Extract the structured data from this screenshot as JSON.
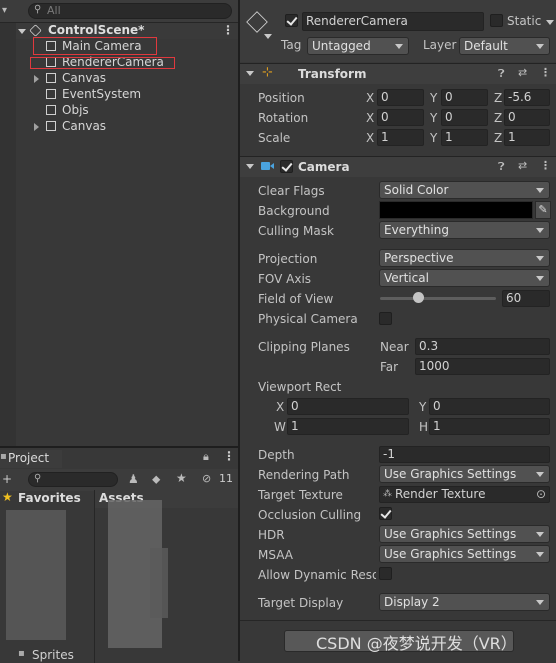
{
  "hierarchy": {
    "search_placeholder": "All",
    "scene_name": "ControlScene*",
    "items": [
      {
        "label": "Main Camera",
        "expandable": false,
        "highlight": true
      },
      {
        "label": "RendererCamera",
        "expandable": false,
        "highlight": true
      },
      {
        "label": "Canvas",
        "expandable": true,
        "highlight": false
      },
      {
        "label": "EventSystem",
        "expandable": false,
        "highlight": false
      },
      {
        "label": "Objs",
        "expandable": false,
        "highlight": false
      },
      {
        "label": "Canvas",
        "expandable": true,
        "highlight": false
      }
    ]
  },
  "project": {
    "tab_label": "Project",
    "hidden_count": "11",
    "favorites_label": "Favorites",
    "assets_label": "Assets",
    "sprites_label": "Sprites"
  },
  "inspector": {
    "object_name": "RendererCamera",
    "static_label": "Static",
    "tag_label": "Tag",
    "tag_value": "Untagged",
    "layer_label": "Layer",
    "layer_value": "Default",
    "transform": {
      "title": "Transform",
      "position": {
        "label": "Position",
        "x": "0",
        "y": "0",
        "z": "-5.6"
      },
      "rotation": {
        "label": "Rotation",
        "x": "0",
        "y": "0",
        "z": "0"
      },
      "scale": {
        "label": "Scale",
        "x": "1",
        "y": "1",
        "z": "1"
      }
    },
    "camera": {
      "title": "Camera",
      "clear_flags_label": "Clear Flags",
      "clear_flags_value": "Solid Color",
      "background_label": "Background",
      "background_color": "#000000",
      "culling_mask_label": "Culling Mask",
      "culling_mask_value": "Everything",
      "projection_label": "Projection",
      "projection_value": "Perspective",
      "fov_axis_label": "FOV Axis",
      "fov_axis_value": "Vertical",
      "fov_label": "Field of View",
      "fov_value": "60",
      "fov_slider_fraction": 0.33,
      "physical_camera_label": "Physical Camera",
      "clipping_label": "Clipping Planes",
      "near_label": "Near",
      "near_value": "0.3",
      "far_label": "Far",
      "far_value": "1000",
      "viewport_label": "Viewport Rect",
      "vp_x": "0",
      "vp_y": "0",
      "vp_w": "1",
      "vp_h": "1",
      "depth_label": "Depth",
      "depth_value": "-1",
      "rendering_path_label": "Rendering Path",
      "rendering_path_value": "Use Graphics Settings",
      "target_texture_label": "Target Texture",
      "target_texture_value": "Render Texture",
      "occlusion_label": "Occlusion Culling",
      "hdr_label": "HDR",
      "hdr_value": "Use Graphics Settings",
      "msaa_label": "MSAA",
      "msaa_value": "Use Graphics Settings",
      "dynamic_res_label": "Allow Dynamic Resol",
      "target_display_label": "Target Display",
      "target_display_value": "Display 2"
    }
  },
  "watermark": "CSDN @夜梦说开发（VR）",
  "colors": {
    "highlight_box": "#e0393e",
    "panel_bg": "#383838",
    "field_bg": "#2a2a2a"
  }
}
